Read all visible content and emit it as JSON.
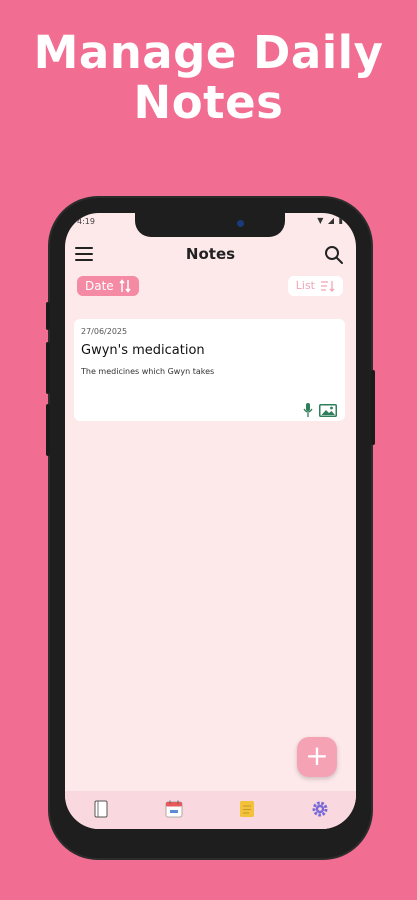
{
  "promo": {
    "headline": "Manage Daily Notes"
  },
  "status_bar": {
    "time": "4:19"
  },
  "app_bar": {
    "title": "Notes",
    "menu_icon": "hamburger-menu-icon",
    "search_icon": "search-icon"
  },
  "sort_chip": {
    "label": "Date",
    "icon": "sort-arrows-icon"
  },
  "view_chip": {
    "label": "List",
    "icon": "list-sort-icon"
  },
  "notes": [
    {
      "date": "27/06/2025",
      "title": "Gwyn's medication",
      "description": "The medicines which Gwyn takes",
      "attachments": [
        "mic-icon",
        "image-icon"
      ]
    }
  ],
  "fab": {
    "label": "+"
  },
  "bottom_nav": {
    "items": [
      {
        "name": "journal",
        "icon": "journal-icon"
      },
      {
        "name": "calendar",
        "icon": "calendar-icon"
      },
      {
        "name": "notes",
        "icon": "sticky-note-icon"
      },
      {
        "name": "settings",
        "icon": "gear-icon"
      }
    ]
  },
  "colors": {
    "background": "#f26d92",
    "screen": "#fde8ea",
    "accent": "#f48aa3",
    "icon_green": "#2e7d5b",
    "icon_gold": "#f2c23a",
    "icon_purple": "#7a6ad8"
  }
}
